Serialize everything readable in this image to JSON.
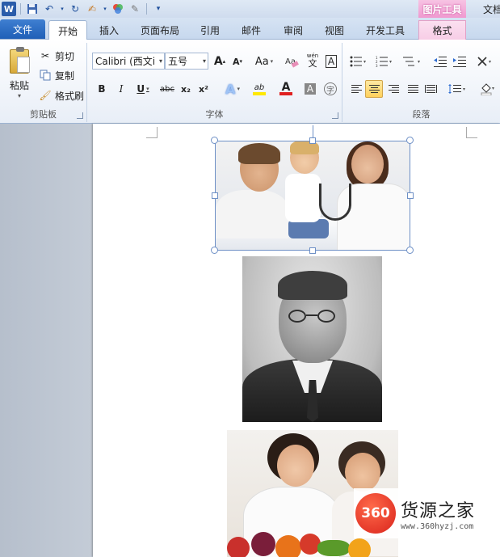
{
  "qat": {
    "app_icon": "W",
    "icons": [
      "save-icon",
      "undo-icon",
      "redo-icon",
      "format-painter-icon",
      "color-icon",
      "clear-icon",
      "customize-icon"
    ]
  },
  "title": {
    "context_header": "图片工具",
    "document_title": "文档"
  },
  "tabs": [
    {
      "label": "文件"
    },
    {
      "label": "开始"
    },
    {
      "label": "插入"
    },
    {
      "label": "页面布局"
    },
    {
      "label": "引用"
    },
    {
      "label": "邮件"
    },
    {
      "label": "审阅"
    },
    {
      "label": "视图"
    },
    {
      "label": "开发工具"
    },
    {
      "label": "格式"
    }
  ],
  "clipboard": {
    "paste_label": "粘贴",
    "cut_label": "剪切",
    "copy_label": "复制",
    "format_painter_label": "格式刷",
    "group_label": "剪贴板"
  },
  "font": {
    "font_name": "Calibri (西文i",
    "font_size": "五号",
    "grow": "A",
    "shrink": "A",
    "change_case": "Aa",
    "phonetic": "wén",
    "border_char": "A",
    "bold": "B",
    "italic": "I",
    "underline": "U",
    "strikethrough": "abc",
    "subscript": "x₂",
    "superscript": "x²",
    "text_effect": "A",
    "highlight": "ab",
    "font_color": "A",
    "char_shading": "A",
    "enclose": "字",
    "group_label": "字体"
  },
  "paragraph": {
    "group_label": "段落",
    "align_selected": "center"
  },
  "watermark": {
    "logo_text": "360",
    "title": "货源之家",
    "url": "www.360hyzj.com"
  },
  "colors": {
    "file_tab": "#2a6bc5",
    "context_tab": "#f09ad0",
    "selection": "#6e90c6",
    "highlight_yellow": "#ffe800",
    "font_red": "#e02020",
    "watermark_red": "#d9231b"
  }
}
